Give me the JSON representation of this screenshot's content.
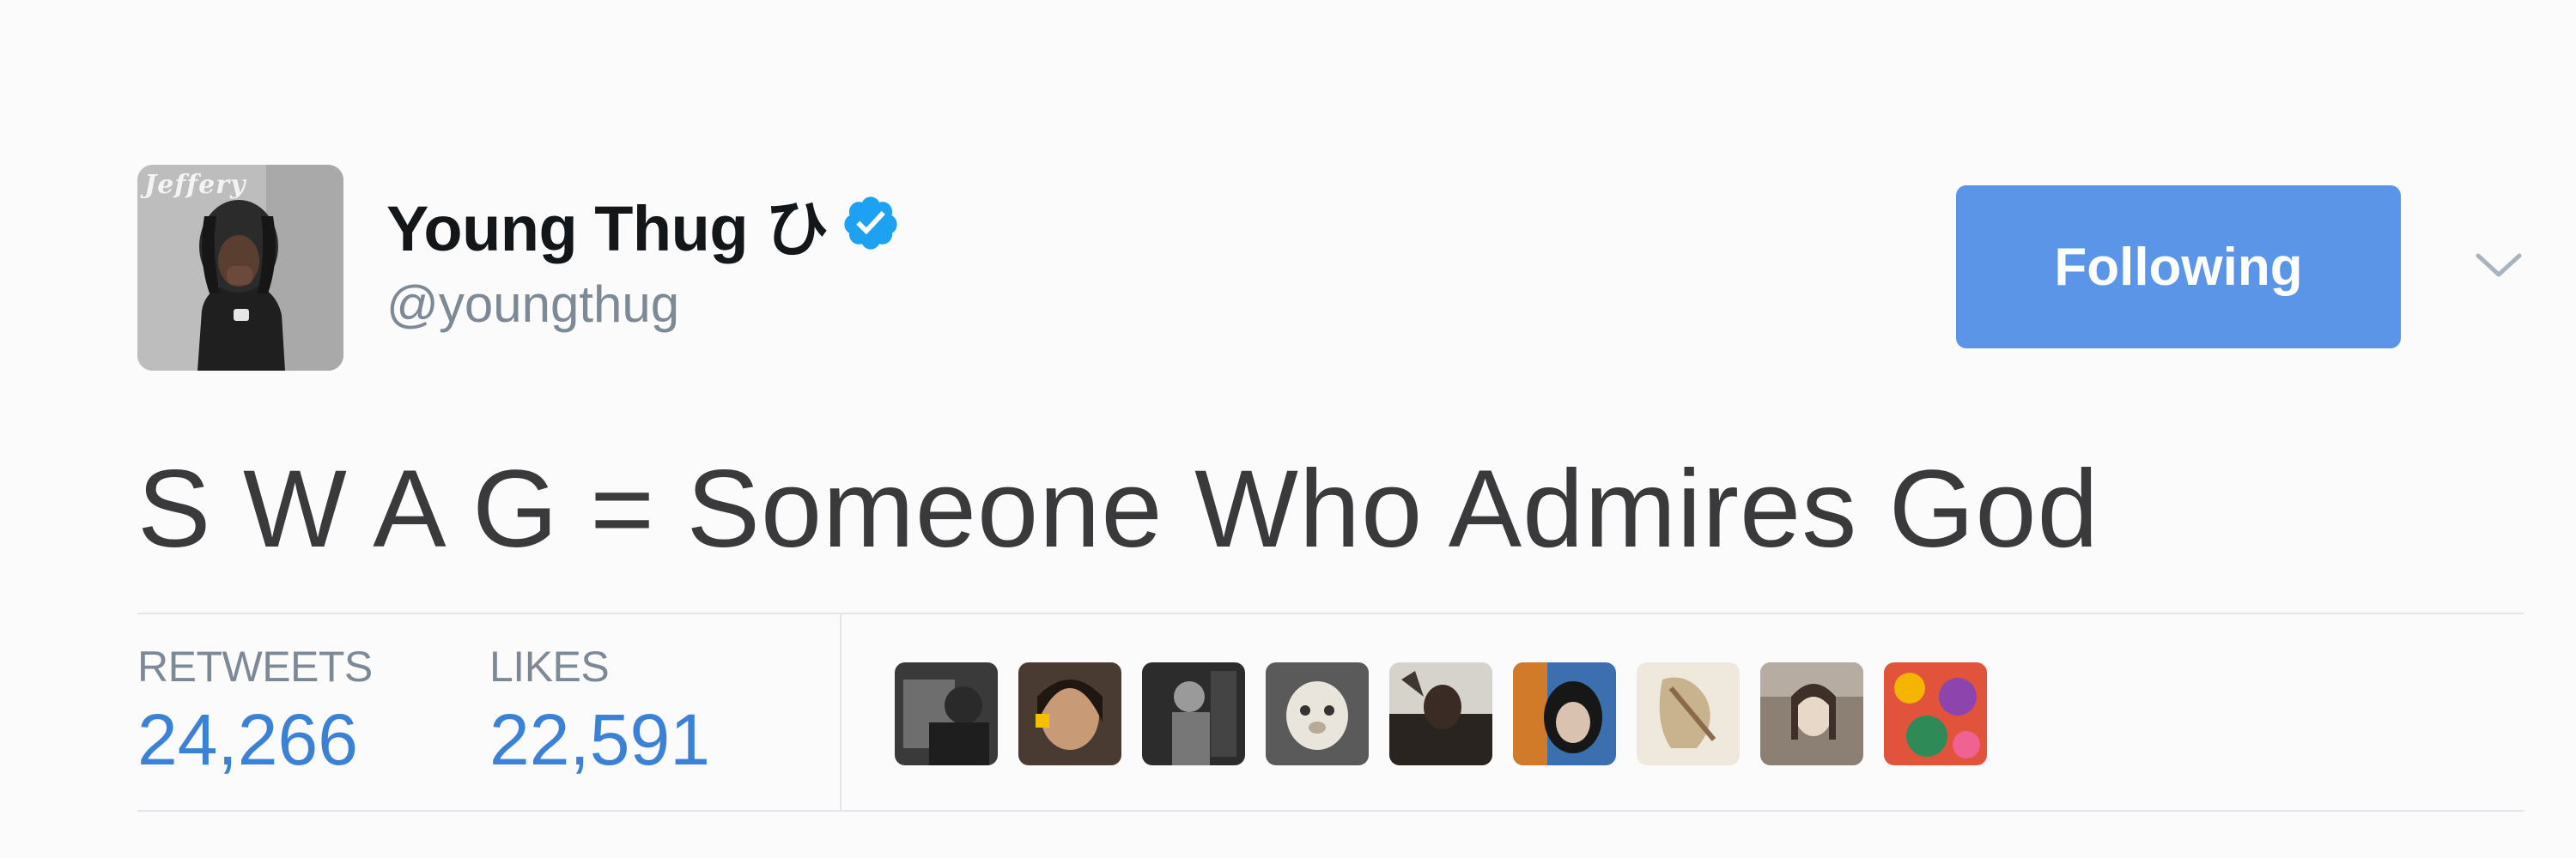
{
  "tweet": {
    "author": {
      "display_name": "Young Thug ひ",
      "handle": "@youngthug",
      "avatar_watermark": "Jeffery",
      "verified": true
    },
    "follow_button_label": "Following",
    "text": "S W A G = Someone Who Admires God",
    "stats": {
      "retweets_label": "RETWEETS",
      "retweets_value": "24,266",
      "likes_label": "LIKES",
      "likes_value": "22,591"
    },
    "liker_avatar_count": 9
  },
  "colors": {
    "follow_button": "#5b95e8",
    "stat_value": "#3b82d6",
    "verified_badge": "#1da1f2",
    "handle_gray": "#7d8a96"
  },
  "icons": {
    "verified": "verified-badge-icon",
    "menu": "chevron-down-icon"
  }
}
